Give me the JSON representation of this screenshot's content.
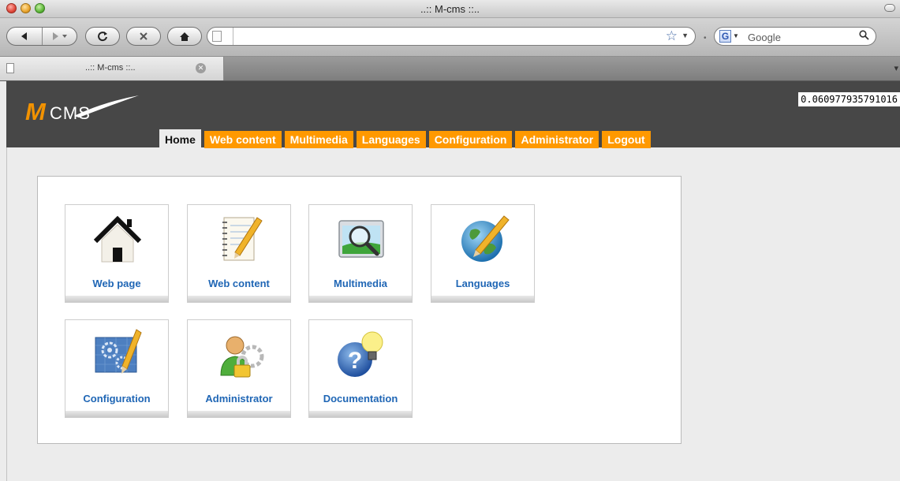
{
  "window": {
    "title": "..:: M-cms ::.."
  },
  "toolbar": {
    "url_value": "",
    "search_placeholder": "Google",
    "search_engine_letter": "G"
  },
  "tab": {
    "label": "..:: M-cms ::.."
  },
  "cms": {
    "logo_letter": "M",
    "logo_text": "CMS",
    "random_number": "0.060977935791016",
    "menu": [
      {
        "label": "Home",
        "active": true
      },
      {
        "label": "Web content"
      },
      {
        "label": "Multimedia"
      },
      {
        "label": "Languages"
      },
      {
        "label": "Configuration"
      },
      {
        "label": "Administrator"
      },
      {
        "label": "Logout"
      }
    ],
    "tiles": [
      {
        "label": "Web page",
        "icon": "house-icon"
      },
      {
        "label": "Web content",
        "icon": "notepad-pencil-icon"
      },
      {
        "label": "Multimedia",
        "icon": "image-magnifier-icon"
      },
      {
        "label": "Languages",
        "icon": "globe-pencil-icon"
      },
      {
        "label": "Configuration",
        "icon": "gears-blueprint-icon"
      },
      {
        "label": "Administrator",
        "icon": "user-lock-icon"
      },
      {
        "label": "Documentation",
        "icon": "help-lightbulb-icon"
      }
    ]
  },
  "colors": {
    "accent": "#ff9900",
    "header_bg": "#474747",
    "link": "#1f66b5"
  }
}
